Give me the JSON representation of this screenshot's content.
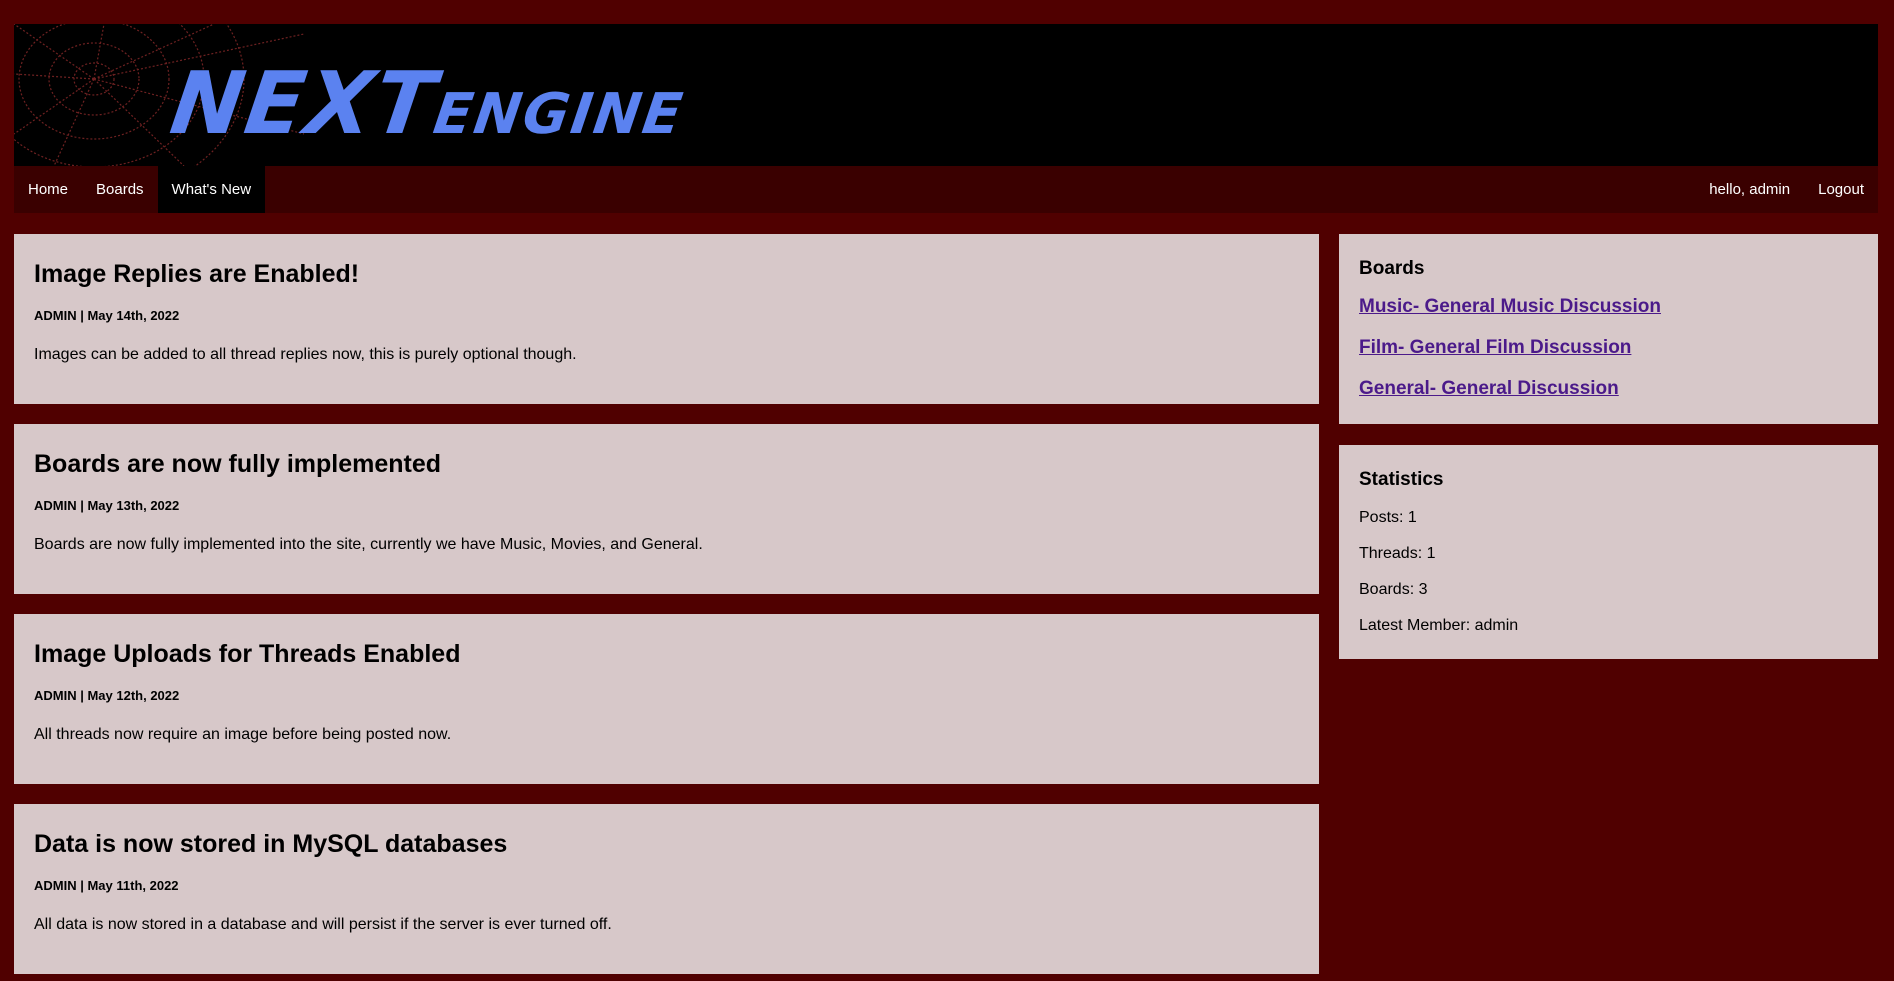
{
  "logo": {
    "text_big": "NEXT",
    "text_small": "ENGINE"
  },
  "nav": {
    "home": "Home",
    "boards": "Boards",
    "whats_new": "What's New",
    "greeting": "hello, admin",
    "logout": "Logout"
  },
  "posts": [
    {
      "title": "Image Replies are Enabled!",
      "meta": "ADMIN | May 14th, 2022",
      "body": "Images can be added to all thread replies now, this is purely optional though."
    },
    {
      "title": "Boards are now fully implemented",
      "meta": "ADMIN | May 13th, 2022",
      "body": "Boards are now fully implemented into the site, currently we have Music, Movies, and General."
    },
    {
      "title": "Image Uploads for Threads Enabled",
      "meta": "ADMIN | May 12th, 2022",
      "body": "All threads now require an image before being posted now."
    },
    {
      "title": "Data is now stored in MySQL databases",
      "meta": "ADMIN | May 11th, 2022",
      "body": "All data is now stored in a database and will persist if the server is ever turned off."
    }
  ],
  "boards_panel": {
    "title": "Boards",
    "links": [
      "Music- General Music Discussion",
      "Film- General Film Discussion",
      "General- General Discussion"
    ]
  },
  "stats_panel": {
    "title": "Statistics",
    "posts": "Posts: 1",
    "threads": "Threads: 1",
    "boards": "Boards: 3",
    "latest_member": "Latest Member: admin"
  },
  "colors": {
    "background": "#500000",
    "nav": "#3a0000",
    "card": "#d7c8c9",
    "link": "#4b1a8a",
    "logo": "#5b82f0"
  }
}
